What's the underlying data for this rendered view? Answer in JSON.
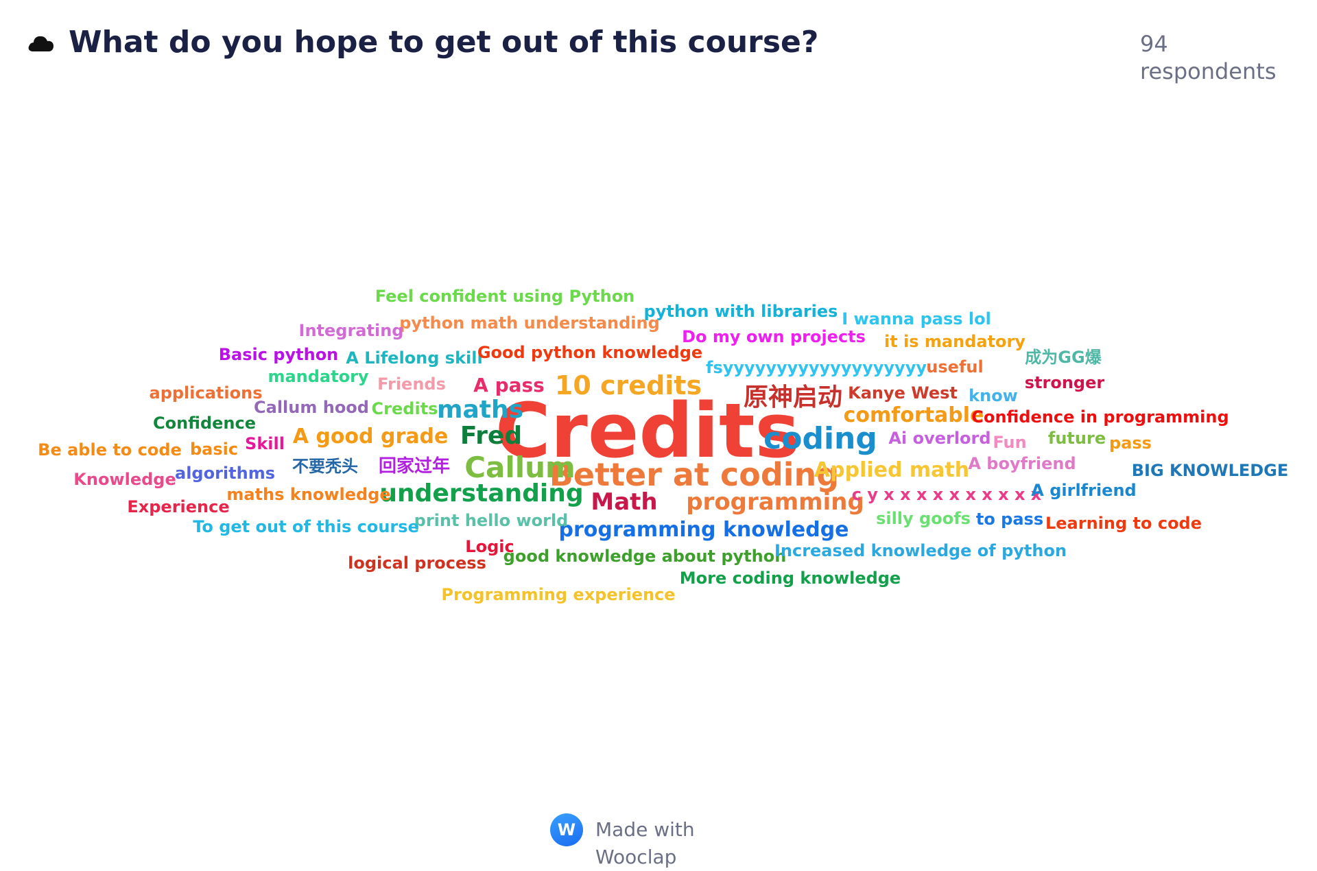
{
  "header": {
    "icon": "cloud-icon",
    "title": "What do you hope to get out of this course?",
    "respondents": "94 respondents"
  },
  "footer": {
    "logo_letter": "W",
    "text": "Made with Wooclap"
  },
  "words": [
    {
      "text": "Credits",
      "color": "#ef4136",
      "size": 110
    },
    {
      "text": "Better at coding",
      "color": "#ed7a3a",
      "size": 46
    },
    {
      "text": "coding",
      "color": "#1b8fcd",
      "size": 44
    },
    {
      "text": "Callum",
      "color": "#7dbd41",
      "size": 42
    },
    {
      "text": "10 credits",
      "color": "#f5a623",
      "size": 38
    },
    {
      "text": "原神启动",
      "color": "#c8302c",
      "size": 36
    },
    {
      "text": "understanding",
      "color": "#12a04a",
      "size": 36
    },
    {
      "text": "Fred",
      "color": "#0d7e3c",
      "size": 36
    },
    {
      "text": "maths",
      "color": "#20a5c9",
      "size": 36
    },
    {
      "text": "programming",
      "color": "#ed7a3a",
      "size": 34
    },
    {
      "text": "Math",
      "color": "#c8184a",
      "size": 34
    },
    {
      "text": "programming knowledge",
      "color": "#1570e6",
      "size": 30
    },
    {
      "text": "A good grade",
      "color": "#f59a14",
      "size": 30
    },
    {
      "text": "Applied math",
      "color": "#f7c634",
      "size": 30
    },
    {
      "text": "comfortable",
      "color": "#f59a14",
      "size": 30
    },
    {
      "text": "A pass",
      "color": "#e82c6a",
      "size": 28
    },
    {
      "text": "回家过年",
      "color": "#b21fe0",
      "size": 26
    },
    {
      "text": "Feel confident using Python",
      "color": "#6ad94a",
      "size": 24
    },
    {
      "text": "python with libraries",
      "color": "#14b2d9",
      "size": 24
    },
    {
      "text": "I wanna pass lol",
      "color": "#2cc5f0",
      "size": 24
    },
    {
      "text": "python math understanding",
      "color": "#f58a4a",
      "size": 24
    },
    {
      "text": "Integrating",
      "color": "#d26ad6",
      "size": 24
    },
    {
      "text": "Do my own projects",
      "color": "#f01ef0",
      "size": 24
    },
    {
      "text": "it is mandatory",
      "color": "#f5a20e",
      "size": 24
    },
    {
      "text": "Basic python",
      "color": "#bb10e8",
      "size": 24
    },
    {
      "text": "A Lifelong skill",
      "color": "#1cb5c0",
      "size": 24
    },
    {
      "text": "Good python knowledge",
      "color": "#ef3a10",
      "size": 24
    },
    {
      "text": "成为GG爆",
      "color": "#4fb7a6",
      "size": 24
    },
    {
      "text": "mandatory",
      "color": "#2bd68a",
      "size": 24
    },
    {
      "text": "fsyyyyyyyyyyyyyyyyyyy",
      "color": "#2ec4ef",
      "size": 24
    },
    {
      "text": "useful",
      "color": "#ee7034",
      "size": 24
    },
    {
      "text": "Friends",
      "color": "#f59aa8",
      "size": 24
    },
    {
      "text": "stronger",
      "color": "#d0134a",
      "size": 24
    },
    {
      "text": "applications",
      "color": "#ee7034",
      "size": 24
    },
    {
      "text": "Kanye West",
      "color": "#cf3a2a",
      "size": 24
    },
    {
      "text": "know",
      "color": "#42b2ec",
      "size": 24
    },
    {
      "text": "Callum hood",
      "color": "#9368b8",
      "size": 24
    },
    {
      "text": "Credits",
      "color": "#6ad94a",
      "size": 24
    },
    {
      "text": "Confidence",
      "color": "#12873c",
      "size": 24
    },
    {
      "text": "Confidence in programming",
      "color": "#ef0e0e",
      "size": 24
    },
    {
      "text": "Be able to code",
      "color": "#f58a14",
      "size": 24
    },
    {
      "text": "basic",
      "color": "#f58a14",
      "size": 24
    },
    {
      "text": "Skill",
      "color": "#e8169a",
      "size": 24
    },
    {
      "text": "Ai overlord",
      "color": "#c660de",
      "size": 24
    },
    {
      "text": "Fun",
      "color": "#f38ac0",
      "size": 24
    },
    {
      "text": "future",
      "color": "#7dbd41",
      "size": 24
    },
    {
      "text": "pass",
      "color": "#f59a14",
      "size": 24
    },
    {
      "text": "不要秃头",
      "color": "#2466a6",
      "size": 24
    },
    {
      "text": "A boyfriend",
      "color": "#e07ac8",
      "size": 24
    },
    {
      "text": "BIG KNOWLEDGE",
      "color": "#1e78b8",
      "size": 24
    },
    {
      "text": "Knowledge",
      "color": "#ea4a8c",
      "size": 24
    },
    {
      "text": "algorithms",
      "color": "#5264e0",
      "size": 24
    },
    {
      "text": "c y x x x x x x x x x x",
      "color": "#ea3a8a",
      "size": 24
    },
    {
      "text": "A girlfriend",
      "color": "#1a88d0",
      "size": 24
    },
    {
      "text": "maths knowledge",
      "color": "#f5821e",
      "size": 24
    },
    {
      "text": "Experience",
      "color": "#e8244a",
      "size": 24
    },
    {
      "text": "silly goofs",
      "color": "#6ae070",
      "size": 24
    },
    {
      "text": "to pass",
      "color": "#1a78e6",
      "size": 24
    },
    {
      "text": "Learning to code",
      "color": "#ef3a10",
      "size": 24
    },
    {
      "text": "print hello world",
      "color": "#5ac0a8",
      "size": 24
    },
    {
      "text": "To get out of this course",
      "color": "#22b8e6",
      "size": 24
    },
    {
      "text": "Logic",
      "color": "#e8143a",
      "size": 24
    },
    {
      "text": "good knowledge about python",
      "color": "#3da02a",
      "size": 24
    },
    {
      "text": "Increased knowledge of python",
      "color": "#2aa8e0",
      "size": 24
    },
    {
      "text": "logical process",
      "color": "#cf3220",
      "size": 24
    },
    {
      "text": "More coding knowledge",
      "color": "#12a04a",
      "size": 24
    },
    {
      "text": "Programming experience",
      "color": "#f5c22a",
      "size": 24
    }
  ]
}
